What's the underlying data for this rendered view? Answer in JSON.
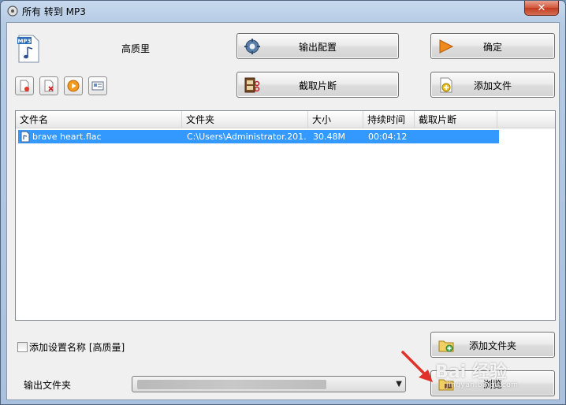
{
  "window": {
    "title": "所有 转到 MP3",
    "close_glyph": "✕"
  },
  "preset": {
    "format_badge": "MP3",
    "quality_label": "高质里"
  },
  "buttons": {
    "output_config": "输出配置",
    "confirm": "确定",
    "clip": "截取片断",
    "add_file": "添加文件",
    "add_folder": "添加文件夹",
    "browse": "浏览"
  },
  "toolbar_icons": [
    "remove-item-icon",
    "clear-list-icon",
    "play-icon",
    "media-info-icon"
  ],
  "file_list": {
    "columns": [
      "文件名",
      "文件夹",
      "大小",
      "持续时间",
      "截取片断"
    ],
    "rows": [
      {
        "name": "brave heart.flac",
        "folder": "C:\\Users\\Administrator.201...",
        "size": "30.48M",
        "duration": "00:04:12",
        "clip": ""
      }
    ]
  },
  "options": {
    "add_setting_name_label": "添加设置名称 [高质量]",
    "add_setting_name_checked": false
  },
  "output": {
    "folder_label": "输出文件夹",
    "dropdown_arrow": "▼"
  },
  "watermark": {
    "brand": "Bai 经验",
    "url": "jingyan.baidu.com"
  },
  "colors": {
    "selection": "#3399ff",
    "annotation_arrow": "#e0302a"
  }
}
